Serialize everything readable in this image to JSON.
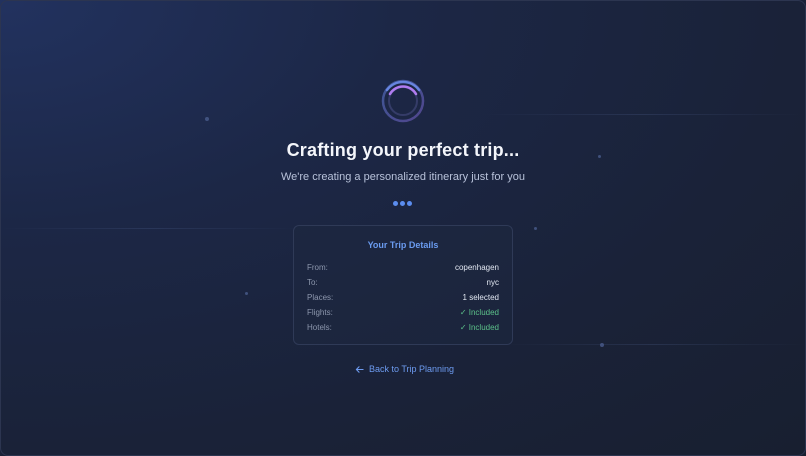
{
  "loading": {
    "title": "Crafting your perfect trip...",
    "subtitle": "We're creating a personalized itinerary just for you"
  },
  "trip_details": {
    "heading": "Your Trip Details",
    "rows": [
      {
        "label": "From:",
        "value": "copenhagen"
      },
      {
        "label": "To:",
        "value": "nyc"
      },
      {
        "label": "Places:",
        "value": "1 selected"
      },
      {
        "label": "Flights:",
        "value": "✓ Included"
      },
      {
        "label": "Hotels:",
        "value": "✓ Included"
      }
    ]
  },
  "navigation": {
    "back_label": "Back to Trip Planning"
  },
  "icons": {
    "spinner": "loading-spinner-icon",
    "back": "arrow-left-icon"
  },
  "colors": {
    "accent": "#6d9bf0",
    "success": "#5cc28a",
    "spinner_arc": "#b07cf0"
  }
}
